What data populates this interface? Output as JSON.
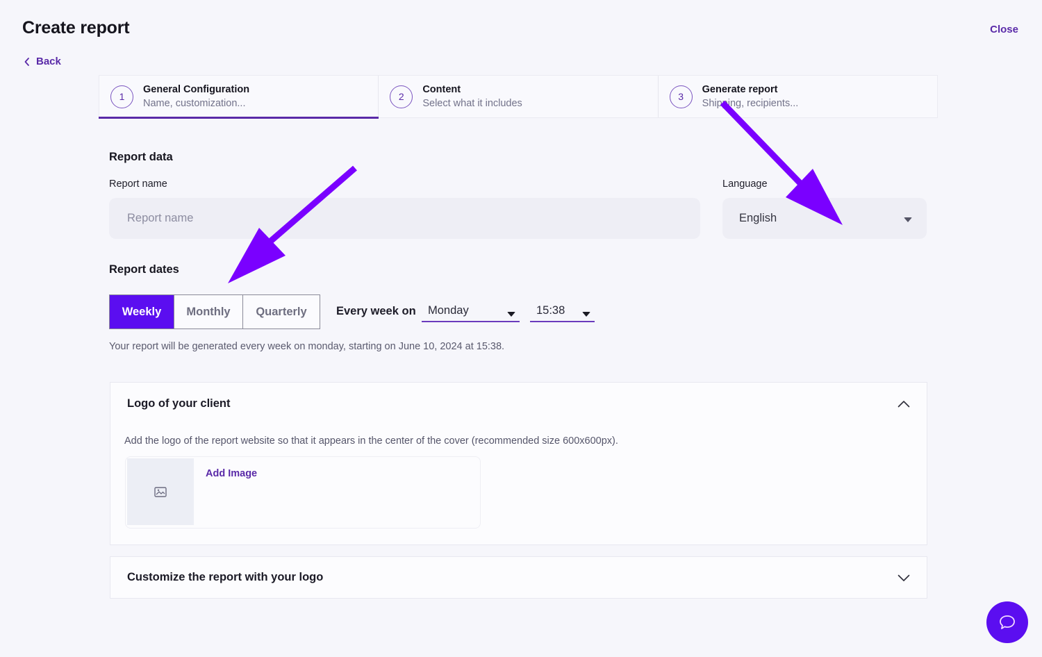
{
  "header": {
    "title": "Create report",
    "close_label": "Close",
    "back_label": "Back"
  },
  "steps": [
    {
      "number": "1",
      "title": "General Configuration",
      "subtitle": "Name, customization...",
      "active": true
    },
    {
      "number": "2",
      "title": "Content",
      "subtitle": "Select what it includes",
      "active": false
    },
    {
      "number": "3",
      "title": "Generate report",
      "subtitle": "Shipping, recipients...",
      "active": false
    }
  ],
  "report_data": {
    "section_title": "Report data",
    "name_label": "Report name",
    "name_value": "",
    "name_placeholder": "Report name",
    "language_label": "Language",
    "language_value": "English"
  },
  "report_dates": {
    "section_title": "Report dates",
    "frequency_options": [
      "Weekly",
      "Monthly",
      "Quarterly"
    ],
    "selected_frequency": "Weekly",
    "every_label": "Every week on",
    "day_value": "Monday",
    "time_value": "15:38",
    "hint": "Your report will be generated every week on monday, starting on June 10, 2024 at 15:38."
  },
  "client_logo": {
    "title": "Logo of your client",
    "expanded": true,
    "description": "Add the logo of the report website so that it appears in the center of the cover (recommended size 600x600px).",
    "add_image_label": "Add Image"
  },
  "custom_logo": {
    "title": "Customize the report with your logo",
    "expanded": false
  },
  "colors": {
    "accent": "#5b0ef0",
    "link": "#5a2aa8",
    "background": "#f6f6fb",
    "annotation_arrow": "#7a00ff"
  },
  "icons": {
    "back": "chevron-left-icon",
    "select": "caret-down-icon",
    "collapse": "chevron-up-icon",
    "expand": "chevron-down-icon",
    "image_placeholder": "image-icon",
    "chat": "chat-bubble-icon"
  }
}
